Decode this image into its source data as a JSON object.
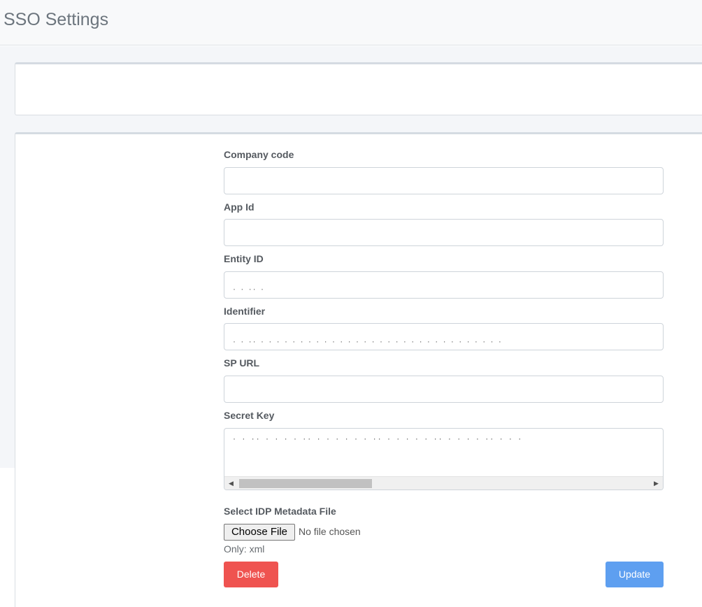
{
  "header": {
    "title": "SSO Settings"
  },
  "form": {
    "company_code": {
      "label": "Company code",
      "value": ""
    },
    "app_id": {
      "label": "App Id",
      "value": ""
    },
    "entity_id": {
      "label": "Entity ID",
      "value": ""
    },
    "identifier": {
      "label": "Identifier",
      "value": ""
    },
    "sp_url": {
      "label": "SP URL",
      "value": ""
    },
    "secret_key": {
      "label": "Secret Key",
      "value": ""
    },
    "idp_file": {
      "label": "Select IDP Metadata File",
      "button_label": "Choose File",
      "status": "No file chosen",
      "hint": "Only: xml"
    }
  },
  "actions": {
    "delete_label": "Delete",
    "update_label": "Update"
  },
  "colors": {
    "delete": "#ef5350",
    "update": "#5e9ff0",
    "header_bg": "#f8f9fa",
    "page_bg": "#f4f6f9"
  },
  "icons": {
    "scroll_left": "triangle-left-icon",
    "scroll_right": "triangle-right-icon"
  }
}
